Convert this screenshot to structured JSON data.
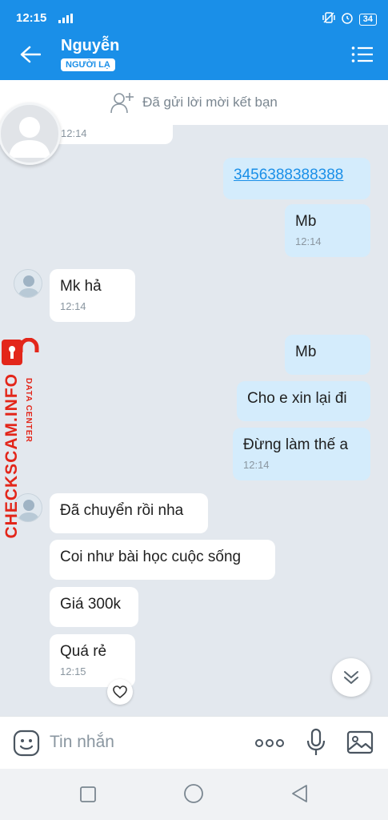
{
  "status_bar": {
    "time": "12:15",
    "battery": "34"
  },
  "header": {
    "contact_name": "Nguyễn",
    "badge": "NGƯỜI LẠ"
  },
  "friend_banner": {
    "text": "Đã gửi lời mời kết bạn"
  },
  "watermark": {
    "brand": "CHECKSCAM.INFO",
    "sub": "DATA CENTER",
    "color": "#e3261a"
  },
  "messages": [
    {
      "side": "in",
      "time": "12:14"
    },
    {
      "side": "out",
      "text": "3456388388388",
      "is_link": true
    },
    {
      "side": "out",
      "text": "Mb",
      "time": "12:14"
    },
    {
      "side": "in",
      "text": "Mk hả",
      "time": "12:14"
    },
    {
      "side": "out",
      "text": "Mb"
    },
    {
      "side": "out",
      "text": "Cho e xin lại đi"
    },
    {
      "side": "out",
      "text": "Đừng làm thế a",
      "time": "12:14"
    },
    {
      "side": "in",
      "text": "Đã chuyển rồi nha"
    },
    {
      "side": "in",
      "text": "Coi như bài học cuộc sống"
    },
    {
      "side": "in",
      "text": "Giá 300k"
    },
    {
      "side": "in",
      "text": "Quá rẻ",
      "time": "12:15"
    }
  ],
  "input": {
    "placeholder": "Tin nhắn"
  },
  "colors": {
    "accent": "#1a8fe8",
    "outgoing_bubble": "#d4ecfc",
    "incoming_bubble": "#ffffff",
    "background": "#e3e8ee"
  }
}
